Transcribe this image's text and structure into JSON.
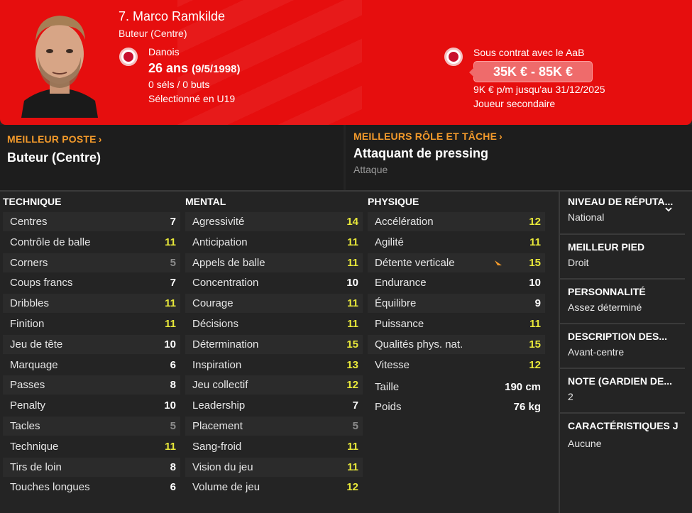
{
  "header": {
    "name": "7. Marco Ramkilde",
    "position": "Buteur (Centre)",
    "nationality": "Danois",
    "age": "26 ans",
    "dob": "(9/5/1998)",
    "caps": "0 séls / 0 buts",
    "selection": "Sélectionné en U19",
    "contract": "Sous contrat avec le AaB",
    "value": "35K € - 85K €",
    "wage": "9K € p/m jusqu'au 31/12/2025",
    "squad_status": "Joueur secondaire"
  },
  "best_position": {
    "label": "MEILLEUR POSTE",
    "value": "Buteur (Centre)"
  },
  "best_role": {
    "label": "MEILLEURS RÔLE ET TÂCHE",
    "value": "Attaquant de pressing",
    "duty": "Attaque"
  },
  "technical": {
    "title": "TECHNIQUE",
    "rows": [
      {
        "label": "Centres",
        "value": "7",
        "color": "white"
      },
      {
        "label": "Contrôle de balle",
        "value": "11",
        "color": "yellow"
      },
      {
        "label": "Corners",
        "value": "5",
        "color": "grey"
      },
      {
        "label": "Coups francs",
        "value": "7",
        "color": "white"
      },
      {
        "label": "Dribbles",
        "value": "11",
        "color": "yellow"
      },
      {
        "label": "Finition",
        "value": "11",
        "color": "yellow"
      },
      {
        "label": "Jeu de tête",
        "value": "10",
        "color": "white"
      },
      {
        "label": "Marquage",
        "value": "6",
        "color": "white"
      },
      {
        "label": "Passes",
        "value": "8",
        "color": "white"
      },
      {
        "label": "Penalty",
        "value": "10",
        "color": "white"
      },
      {
        "label": "Tacles",
        "value": "5",
        "color": "grey"
      },
      {
        "label": "Technique",
        "value": "11",
        "color": "yellow"
      },
      {
        "label": "Tirs de loin",
        "value": "8",
        "color": "white"
      },
      {
        "label": "Touches longues",
        "value": "6",
        "color": "white"
      }
    ]
  },
  "mental": {
    "title": "MENTAL",
    "rows": [
      {
        "label": "Agressivité",
        "value": "14",
        "color": "yellow"
      },
      {
        "label": "Anticipation",
        "value": "11",
        "color": "yellow"
      },
      {
        "label": "Appels de balle",
        "value": "11",
        "color": "yellow"
      },
      {
        "label": "Concentration",
        "value": "10",
        "color": "white"
      },
      {
        "label": "Courage",
        "value": "11",
        "color": "yellow"
      },
      {
        "label": "Décisions",
        "value": "11",
        "color": "yellow"
      },
      {
        "label": "Détermination",
        "value": "15",
        "color": "yellow"
      },
      {
        "label": "Inspiration",
        "value": "13",
        "color": "yellow"
      },
      {
        "label": "Jeu collectif",
        "value": "12",
        "color": "yellow"
      },
      {
        "label": "Leadership",
        "value": "7",
        "color": "white"
      },
      {
        "label": "Placement",
        "value": "5",
        "color": "grey"
      },
      {
        "label": "Sang-froid",
        "value": "11",
        "color": "yellow"
      },
      {
        "label": "Vision du jeu",
        "value": "11",
        "color": "yellow"
      },
      {
        "label": "Volume de jeu",
        "value": "12",
        "color": "yellow"
      }
    ]
  },
  "physical": {
    "title": "PHYSIQUE",
    "rows": [
      {
        "label": "Accélération",
        "value": "12",
        "color": "yellow"
      },
      {
        "label": "Agilité",
        "value": "11",
        "color": "yellow"
      },
      {
        "label": "Détente verticale",
        "value": "15",
        "color": "yellow"
      },
      {
        "label": "Endurance",
        "value": "10",
        "color": "white"
      },
      {
        "label": "Équilibre",
        "value": "9",
        "color": "white"
      },
      {
        "label": "Puissance",
        "value": "11",
        "color": "yellow"
      },
      {
        "label": "Qualités phys. nat.",
        "value": "15",
        "color": "yellow"
      },
      {
        "label": "Vitesse",
        "value": "12",
        "color": "yellow"
      }
    ],
    "height_label": "Taille",
    "height": "190 cm",
    "weight_label": "Poids",
    "weight": "76 kg"
  },
  "info": {
    "reputation_title": "NIVEAU DE RÉPUTA...",
    "reputation": "National",
    "foot_title": "MEILLEUR PIED",
    "foot": "Droit",
    "personality_title": "PERSONNALITÉ",
    "personality": "Assez déterminé",
    "description_title": "DESCRIPTION DES...",
    "description": "Avant-centre",
    "gk_title": "NOTE (GARDIEN DE...",
    "gk": "2",
    "traits_title": "CARACTÉRISTIQUES J",
    "traits": "Aucune"
  },
  "colors": {
    "header_red": "#e60e0e",
    "accent_orange": "#f39a2b",
    "attr_yellow": "#e8e83a",
    "attr_grey": "#8c8c8c"
  }
}
